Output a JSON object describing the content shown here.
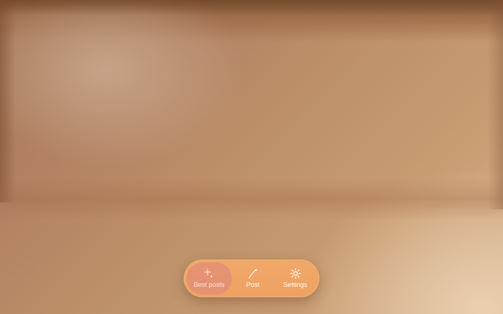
{
  "nav": {
    "items": [
      {
        "label": "Best posts",
        "icon": "sparkle-icon",
        "active": true
      },
      {
        "label": "Post",
        "icon": "pen-icon",
        "active": false
      },
      {
        "label": "Settings",
        "icon": "gear-icon",
        "active": false
      }
    ]
  },
  "colors": {
    "dock": "#f0a868",
    "dock_active": "#e08c78",
    "background_warm": "#c0946b"
  }
}
